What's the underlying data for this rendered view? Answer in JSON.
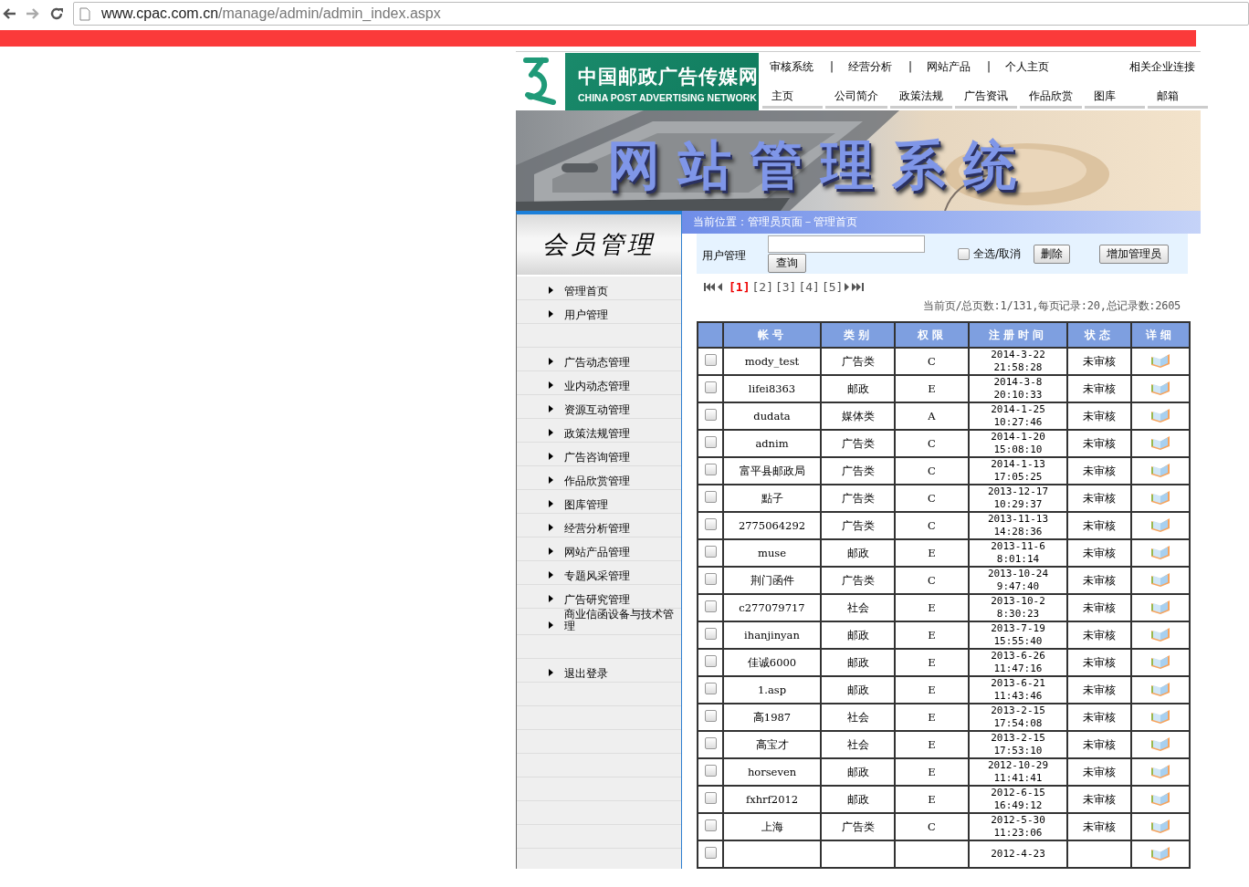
{
  "browser": {
    "url_host": "www.cpac.com.cn",
    "url_path": "/manage/admin/admin_index.aspx"
  },
  "header": {
    "logo_cn": "中国邮政广告传媒网",
    "logo_en": "CHINA POST ADVERTISING NETWORK",
    "top_links": [
      "审核系统",
      "|",
      "经营分析",
      "|",
      "网站产品",
      "|",
      "个人主页"
    ],
    "related": "相关企业连接",
    "nav": [
      "主页",
      "公司简介",
      "政策法规",
      "广告资讯",
      "作品欣赏",
      "图库",
      "邮箱"
    ]
  },
  "banner": {
    "title": "网站管理系统"
  },
  "sidebar": {
    "title": "会员管理",
    "items": [
      {
        "kind": "link",
        "label": "管理首页"
      },
      {
        "kind": "link",
        "label": "用户管理"
      },
      {
        "kind": "blank"
      },
      {
        "kind": "link",
        "label": "广告动态管理"
      },
      {
        "kind": "link",
        "label": "业内动态管理"
      },
      {
        "kind": "link",
        "label": "资源互动管理"
      },
      {
        "kind": "link",
        "label": "政策法规管理"
      },
      {
        "kind": "link",
        "label": "广告咨询管理"
      },
      {
        "kind": "link",
        "label": "作品欣赏管理"
      },
      {
        "kind": "link",
        "label": "图库管理"
      },
      {
        "kind": "link",
        "label": "经营分析管理"
      },
      {
        "kind": "link",
        "label": "网站产品管理"
      },
      {
        "kind": "link",
        "label": "专题风采管理"
      },
      {
        "kind": "link",
        "label": "广告研究管理"
      },
      {
        "kind": "link",
        "label": "商业信函设备与技术管理"
      },
      {
        "kind": "blank"
      },
      {
        "kind": "link",
        "label": "退出登录"
      },
      {
        "kind": "blank"
      },
      {
        "kind": "blank"
      },
      {
        "kind": "blank"
      },
      {
        "kind": "blank"
      },
      {
        "kind": "blank"
      },
      {
        "kind": "blank"
      },
      {
        "kind": "blank"
      }
    ]
  },
  "breadcrumb": "当前位置：管理员页面－管理首页",
  "toolbar": {
    "label": "用户管理",
    "search_button": "查询",
    "select_all": {
      "label": "全选/取消",
      "checked": false
    },
    "delete_button": "删除",
    "add_button": "增加管理员"
  },
  "pager": {
    "pages": [
      {
        "label": "[1]",
        "selected": true
      },
      {
        "label": "[2]",
        "selected": false
      },
      {
        "label": "[3]",
        "selected": false
      },
      {
        "label": "[4]",
        "selected": false
      },
      {
        "label": "[5]",
        "selected": false
      }
    ],
    "summary": "当前页/总页数:1/131,每页记录:20,总记录数:2605"
  },
  "table": {
    "columns": [
      "帐号",
      "类别",
      "权限",
      "注册时间",
      "状态",
      "详细"
    ],
    "rows": [
      {
        "checked": false,
        "account": "mody_test",
        "category": "广告类",
        "permission": "C",
        "date": "2014-3-22",
        "time": "21:58:28",
        "status": "未审核"
      },
      {
        "checked": false,
        "account": "lifei8363",
        "category": "邮政",
        "permission": "E",
        "date": "2014-3-8",
        "time": "20:10:33",
        "status": "未审核"
      },
      {
        "checked": false,
        "account": "dudata",
        "category": "媒体类",
        "permission": "A",
        "date": "2014-1-25",
        "time": "10:27:46",
        "status": "未审核"
      },
      {
        "checked": false,
        "account": "adnim",
        "category": "广告类",
        "permission": "C",
        "date": "2014-1-20",
        "time": "15:08:10",
        "status": "未审核"
      },
      {
        "checked": false,
        "account": "富平县邮政局",
        "category": "广告类",
        "permission": "C",
        "date": "2014-1-13",
        "time": "17:05:25",
        "status": "未审核"
      },
      {
        "checked": false,
        "account": "點子",
        "category": "广告类",
        "permission": "C",
        "date": "2013-12-17",
        "time": "10:29:37",
        "status": "未审核"
      },
      {
        "checked": false,
        "account": "2775064292",
        "category": "广告类",
        "permission": "C",
        "date": "2013-11-13",
        "time": "14:28:36",
        "status": "未审核"
      },
      {
        "checked": false,
        "account": "muse",
        "category": "邮政",
        "permission": "E",
        "date": "2013-11-6",
        "time": "8:01:14",
        "status": "未审核"
      },
      {
        "checked": false,
        "account": "荆门函件",
        "category": "广告类",
        "permission": "C",
        "date": "2013-10-24",
        "time": "9:47:40",
        "status": "未审核"
      },
      {
        "checked": false,
        "account": "c277079717",
        "category": "社会",
        "permission": "E",
        "date": "2013-10-2",
        "time": "8:30:23",
        "status": "未审核"
      },
      {
        "checked": false,
        "account": "ihanjinyan",
        "category": "邮政",
        "permission": "E",
        "date": "2013-7-19",
        "time": "15:55:40",
        "status": "未审核"
      },
      {
        "checked": false,
        "account": "佳诚6000",
        "category": "邮政",
        "permission": "E",
        "date": "2013-6-26",
        "time": "11:47:16",
        "status": "未审核"
      },
      {
        "checked": false,
        "account": "1.asp",
        "category": "邮政",
        "permission": "E",
        "date": "2013-6-21",
        "time": "11:43:46",
        "status": "未审核"
      },
      {
        "checked": false,
        "account": "高1987",
        "category": "社会",
        "permission": "E",
        "date": "2013-2-15",
        "time": "17:54:08",
        "status": "未审核"
      },
      {
        "checked": false,
        "account": "高宝才",
        "category": "社会",
        "permission": "E",
        "date": "2013-2-15",
        "time": "17:53:10",
        "status": "未审核"
      },
      {
        "checked": false,
        "account": "horseven",
        "category": "邮政",
        "permission": "E",
        "date": "2012-10-29",
        "time": "11:41:41",
        "status": "未审核"
      },
      {
        "checked": false,
        "account": "fxhrf2012",
        "category": "邮政",
        "permission": "E",
        "date": "2012-6-15",
        "time": "16:49:12",
        "status": "未审核"
      },
      {
        "checked": false,
        "account": "上海",
        "category": "广告类",
        "permission": "C",
        "date": "2012-5-30",
        "time": "11:23:06",
        "status": "未审核"
      },
      {
        "checked": false,
        "date": "2012-4-23"
      }
    ]
  }
}
